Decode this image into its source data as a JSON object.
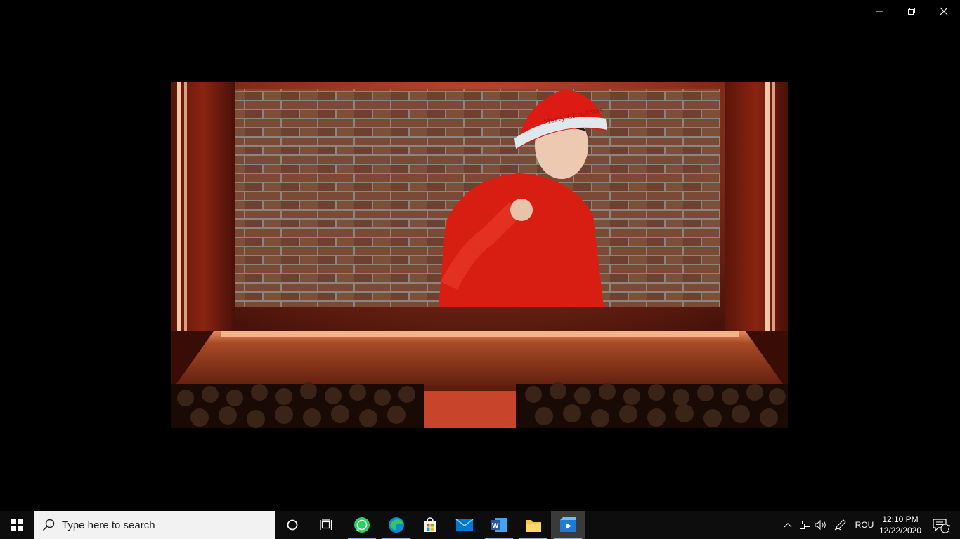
{
  "window": {
    "controls": {
      "minimize_icon": "minimize-icon",
      "restore_icon": "restore-icon",
      "close_icon": "close-icon"
    }
  },
  "video": {
    "scene": "stage-theater",
    "hat_text": "Merry Christmas"
  },
  "taskbar": {
    "start_icon": "windows-logo-icon",
    "search": {
      "placeholder": "Type here to search",
      "icon": "search-icon"
    },
    "pinned_apps": [
      {
        "name": "Cortana",
        "icon": "cortana-icon"
      },
      {
        "name": "Task View",
        "icon": "task-view-icon"
      },
      {
        "name": "WhatsApp",
        "icon": "whatsapp-icon"
      },
      {
        "name": "Microsoft Edge",
        "icon": "edge-icon"
      },
      {
        "name": "Microsoft Store",
        "icon": "store-icon"
      },
      {
        "name": "Mail",
        "icon": "mail-icon"
      },
      {
        "name": "Word",
        "icon": "word-icon"
      },
      {
        "name": "File Explorer",
        "icon": "file-explorer-icon"
      },
      {
        "name": "Video Player",
        "icon": "video-player-icon"
      }
    ],
    "tray": {
      "language": "ROU",
      "time": "12:10 PM",
      "date": "12/22/2020",
      "notification_count": "7"
    }
  },
  "colors": {
    "taskbar_bg": "#0d0d0d",
    "search_bg": "#f2f2f2",
    "active_underline": "#8ab4e8",
    "whatsapp": "#25d366",
    "word": "#2b579a",
    "mail": "#0078d4"
  }
}
